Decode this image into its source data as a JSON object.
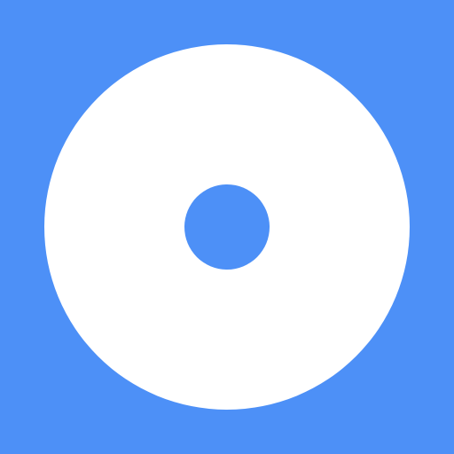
{
  "icon": {
    "name": "disc-icon",
    "background_color": "#4d90f7",
    "disc_color": "#ffffff",
    "hole_color": "#4d90f7"
  }
}
